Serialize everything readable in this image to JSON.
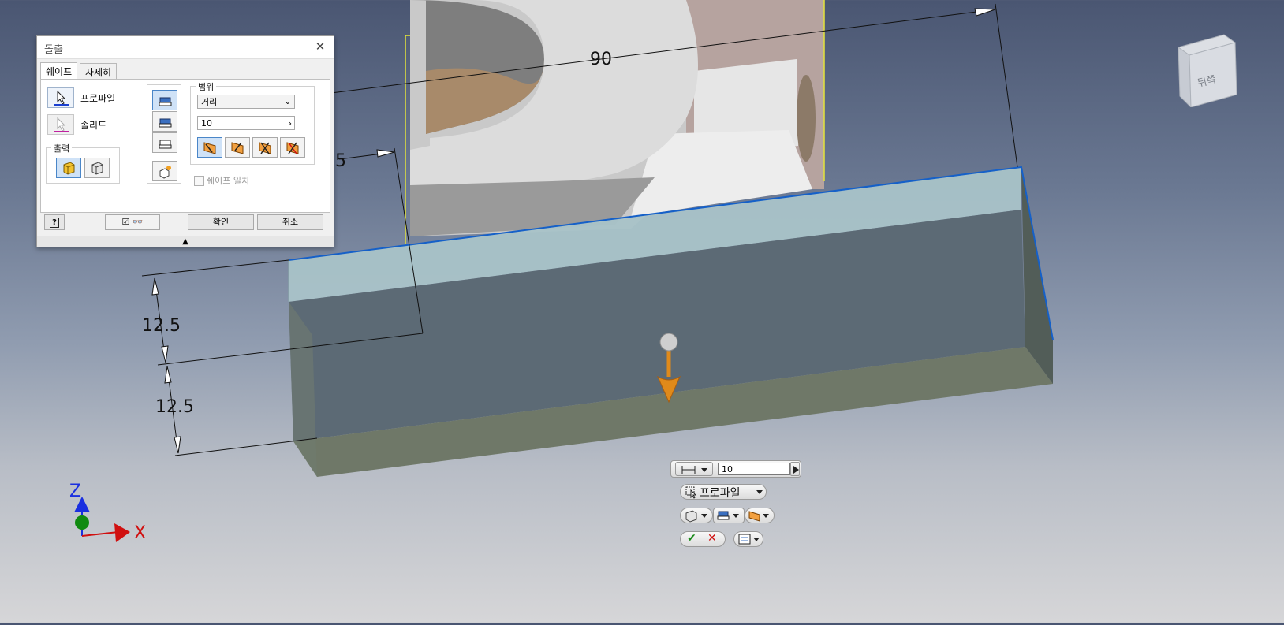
{
  "viewport": {
    "dimensions": {
      "width_label": "90",
      "partial_label": ".5",
      "height_upper": "12.5",
      "height_lower": "12.5"
    },
    "axis": {
      "z": "Z",
      "x": "X"
    },
    "viewcube_face": "뒤쪽"
  },
  "colors": {
    "extrusion_fill": "#5c6a75",
    "extrusion_top": "#a9c3c8",
    "selection_edge": "#1560c8",
    "part_face": "#d8d8d8",
    "arrow": "#e08a1a",
    "axis_z": "#1a2fe0",
    "axis_x": "#d01010",
    "axis_y": "#108a10"
  },
  "dialog": {
    "title": "돌출",
    "tabs": [
      "쉐이프",
      "자세히"
    ],
    "profile_label": "프로파일",
    "solid_label": "솔리드",
    "output_title": "출력",
    "extents_title": "범위",
    "extent_type": "거리",
    "distance_value": "10",
    "match_shape_label": "쉐이프 일치",
    "ok_label": "확인",
    "cancel_label": "취소"
  },
  "mini_toolbar": {
    "distance_value": "10",
    "profile_label": "프로파일"
  }
}
